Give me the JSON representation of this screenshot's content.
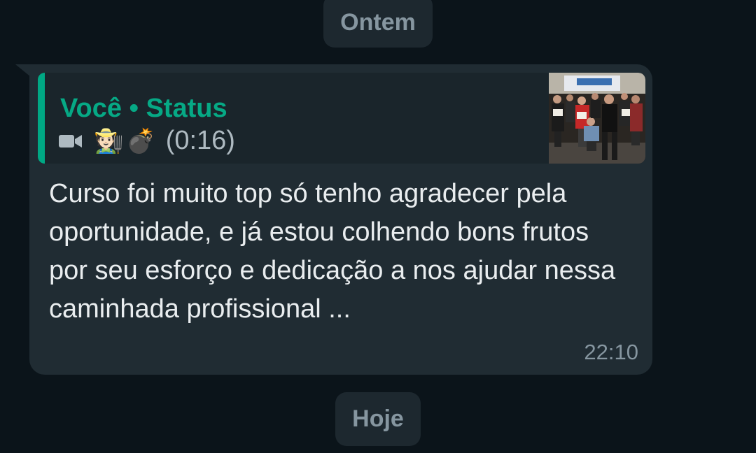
{
  "date_chips": {
    "previous": "Ontem",
    "current": "Hoje"
  },
  "message": {
    "quote": {
      "author": "Você",
      "separator": "•",
      "type": "Status",
      "media_icon": "video-camera-icon",
      "emojis": [
        "🧑🏻‍🌾",
        "💣"
      ],
      "duration": "(0:16)",
      "thumbnail": "group-photo-thumbnail"
    },
    "text": "Curso foi muito top só tenho agradecer pela oportunidade, e já estou colhendo bons frutos por seu esforço e dedicação a nos ajudar nessa caminhada profissional ...",
    "time": "22:10"
  },
  "colors": {
    "background": "#0b141a",
    "bubble": "#202c33",
    "quote_accent": "#00a884",
    "text": "#e9edef",
    "muted": "#8696a0"
  }
}
